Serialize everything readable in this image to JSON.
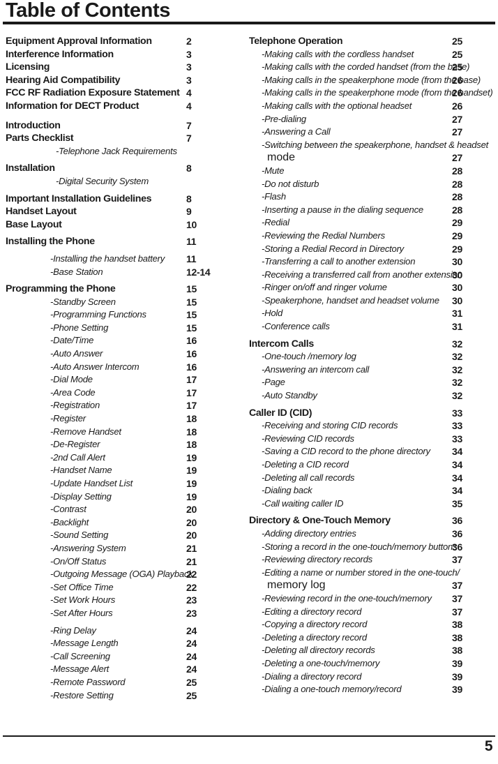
{
  "title": "Table of Contents",
  "footer": {
    "page_number": "5"
  },
  "left_column": [
    {
      "type": "major",
      "label": "Equipment Approval Information",
      "page": "2"
    },
    {
      "type": "major",
      "label": "Interference Information",
      "page": "3"
    },
    {
      "type": "major",
      "label": "Licensing",
      "page": "3"
    },
    {
      "type": "major",
      "label": "Hearing Aid Compatibility",
      "page": "3"
    },
    {
      "type": "major",
      "label": "FCC RF Radiation Exposure Statement",
      "page": "4"
    },
    {
      "type": "major",
      "label": "Information for DECT Product",
      "page": "4"
    },
    {
      "type": "gap",
      "size": "md"
    },
    {
      "type": "major",
      "label": "Introduction",
      "page": "7"
    },
    {
      "type": "major",
      "label": "Parts Checklist",
      "page": "7"
    },
    {
      "type": "sub",
      "deep": true,
      "label": "-Telephone Jack Requirements",
      "page": ""
    },
    {
      "type": "gap",
      "size": "sm"
    },
    {
      "type": "major",
      "label": "Installation",
      "page": "8"
    },
    {
      "type": "sub",
      "deep": true,
      "label": "-Digital Security System",
      "page": ""
    },
    {
      "type": "gap",
      "size": "sm"
    },
    {
      "type": "major",
      "label": "Important Installation Guidelines",
      "page": "8"
    },
    {
      "type": "major",
      "label": "Handset Layout",
      "page": "9"
    },
    {
      "type": "major",
      "label": "Base Layout",
      "page": "10"
    },
    {
      "type": "gap",
      "size": "sm"
    },
    {
      "type": "major",
      "label": "Installing the Phone",
      "page": "11"
    },
    {
      "type": "gap",
      "size": "sm"
    },
    {
      "type": "sub",
      "label": "-Installing the handset battery",
      "page": "11"
    },
    {
      "type": "sub",
      "label": "-Base Station",
      "page": "12-14"
    },
    {
      "type": "gap",
      "size": "sm"
    },
    {
      "type": "major",
      "label": "Programming the Phone",
      "page": "15"
    },
    {
      "type": "sub",
      "label": "-Standby Screen",
      "page": "15"
    },
    {
      "type": "sub",
      "label": "-Programming Functions",
      "page": "15"
    },
    {
      "type": "sub",
      "label": "-Phone Setting",
      "page": "15"
    },
    {
      "type": "sub",
      "label": "-Date/Time",
      "page": "16"
    },
    {
      "type": "sub",
      "label": "-Auto Answer",
      "page": "16"
    },
    {
      "type": "sub",
      "label": "-Auto Answer Intercom",
      "page": "16"
    },
    {
      "type": "sub",
      "label": "-Dial Mode",
      "page": "17"
    },
    {
      "type": "sub",
      "label": "-Area Code",
      "page": "17"
    },
    {
      "type": "sub",
      "label": "-Registration",
      "page": "17"
    },
    {
      "type": "sub",
      "label": "-Register",
      "page": "18"
    },
    {
      "type": "sub",
      "label": "-Remove Handset",
      "page": "18"
    },
    {
      "type": "sub",
      "label": "-De-Register",
      "page": "18"
    },
    {
      "type": "sub",
      "label": "-2nd Call Alert",
      "page": "19"
    },
    {
      "type": "sub",
      "label": "-Handset Name",
      "page": "19"
    },
    {
      "type": "sub",
      "label": "-Update Handset List",
      "page": "19"
    },
    {
      "type": "sub",
      "label": "-Display Setting",
      "page": "19"
    },
    {
      "type": "sub",
      "label": "-Contrast",
      "page": "20"
    },
    {
      "type": "sub",
      "label": "-Backlight",
      "page": "20"
    },
    {
      "type": "sub",
      "label": "-Sound Setting",
      "page": "20"
    },
    {
      "type": "sub",
      "label": "-Answering System",
      "page": "21"
    },
    {
      "type": "sub",
      "label": "-On/Off Status",
      "page": "21"
    },
    {
      "type": "sub",
      "label": "-Outgoing Message (OGA)  Playback",
      "page": "22"
    },
    {
      "type": "sub",
      "label": "-Set Office Time",
      "page": "22"
    },
    {
      "type": "sub",
      "label": "-Set Work Hours",
      "page": "23"
    },
    {
      "type": "sub",
      "label": "-Set After Hours",
      "page": "23"
    },
    {
      "type": "gap",
      "size": "sm"
    },
    {
      "type": "sub",
      "label": "-Ring Delay",
      "page": "24"
    },
    {
      "type": "sub",
      "label": "-Message Length",
      "page": "24"
    },
    {
      "type": "sub",
      "label": "-Call Screening",
      "page": "24"
    },
    {
      "type": "sub",
      "label": "-Message Alert",
      "page": "24"
    },
    {
      "type": "sub",
      "label": "-Remote Password",
      "page": "25"
    },
    {
      "type": "sub",
      "label": "-Restore Setting",
      "page": "25"
    }
  ],
  "right_column": [
    {
      "type": "major",
      "label": "Telephone Operation",
      "page": "25"
    },
    {
      "type": "sub",
      "label": "-Making calls with the cordless handset",
      "page": "25"
    },
    {
      "type": "sub",
      "label": "-Making calls with the corded handset (from the base)",
      "page": "25"
    },
    {
      "type": "sub",
      "label": "-Making calls in the speakerphone mode (from the base)",
      "page": "26"
    },
    {
      "type": "sub",
      "label": "-Making calls in the speakerphone mode (from the handset)",
      "page": "26"
    },
    {
      "type": "sub",
      "label": "-Making calls with the optional headset",
      "page": "26"
    },
    {
      "type": "sub",
      "label": "-Pre-dialing",
      "page": "27"
    },
    {
      "type": "sub",
      "label": "-Answering a Call",
      "page": "27"
    },
    {
      "type": "sub",
      "label": "-Switching between the speakerphone, handset & headset",
      "page": ""
    },
    {
      "type": "cont",
      "label": "mode",
      "page": "27"
    },
    {
      "type": "sub",
      "label": "-Mute",
      "page": "28"
    },
    {
      "type": "sub",
      "label": "-Do not disturb",
      "page": "28"
    },
    {
      "type": "sub",
      "label": "-Flash",
      "page": "28"
    },
    {
      "type": "sub",
      "label": "-Inserting a pause in the dialing sequence",
      "page": "28"
    },
    {
      "type": "sub",
      "label": "-Redial",
      "page": "29"
    },
    {
      "type": "sub",
      "label": "-Reviewing the Redial Numbers",
      "page": "29"
    },
    {
      "type": "sub",
      "label": "-Storing a Redial Record in Directory",
      "page": "29"
    },
    {
      "type": "sub",
      "label": "-Transferring a call to another extension",
      "page": "30"
    },
    {
      "type": "sub",
      "label": "-Receiving a transferred call from another extension",
      "page": "30"
    },
    {
      "type": "sub",
      "label": "-Ringer on/off and ringer volume",
      "page": "30"
    },
    {
      "type": "sub",
      "label": "-Speakerphone, handset and headset volume",
      "page": "30"
    },
    {
      "type": "sub",
      "label": "-Hold",
      "page": "31"
    },
    {
      "type": "sub",
      "label": "-Conference calls",
      "page": "31"
    },
    {
      "type": "gap",
      "size": "sm"
    },
    {
      "type": "major",
      "label": "Intercom Calls",
      "page": "32"
    },
    {
      "type": "sub",
      "label": "-One-touch /memory log",
      "page": "32"
    },
    {
      "type": "sub",
      "label": "-Answering an intercom call",
      "page": "32"
    },
    {
      "type": "sub",
      "label": "-Page",
      "page": "32"
    },
    {
      "type": "sub",
      "label": "-Auto Standby",
      "page": "32"
    },
    {
      "type": "gap",
      "size": "sm"
    },
    {
      "type": "major",
      "label": "Caller ID (CID)",
      "page": "33"
    },
    {
      "type": "sub",
      "label": "-Receiving and storing CID records",
      "page": "33"
    },
    {
      "type": "sub",
      "label": "-Reviewing CID records",
      "page": "33"
    },
    {
      "type": "sub",
      "label": "-Saving a CID record to the phone directory",
      "page": "34"
    },
    {
      "type": "sub",
      "label": "-Deleting a CID record",
      "page": "34"
    },
    {
      "type": "sub",
      "label": "-Deleting all call records",
      "page": "34"
    },
    {
      "type": "sub",
      "label": "-Dialing back",
      "page": "34"
    },
    {
      "type": "sub",
      "label": "-Call waiting caller ID",
      "page": "35"
    },
    {
      "type": "gap",
      "size": "sm"
    },
    {
      "type": "major",
      "label": "Directory & One-Touch Memory",
      "page": "36"
    },
    {
      "type": "sub",
      "label": "-Adding directory entries",
      "page": "36"
    },
    {
      "type": "sub",
      "label": "-Storing a record in the one-touch/memory buttons",
      "page": "36"
    },
    {
      "type": "sub",
      "label": "-Reviewing directory records",
      "page": "37"
    },
    {
      "type": "sub",
      "label": "-Editing a name or number stored in the one-touch/",
      "page": ""
    },
    {
      "type": "cont",
      "label": "memory log",
      "page": "37"
    },
    {
      "type": "sub",
      "label": "-Reviewing record in the one-touch/memory",
      "page": "37"
    },
    {
      "type": "sub",
      "label": "-Editing a directory record",
      "page": "37"
    },
    {
      "type": "sub",
      "label": "-Copying a directory record",
      "page": "38"
    },
    {
      "type": "sub",
      "label": "-Deleting a directory record",
      "page": "38"
    },
    {
      "type": "sub",
      "label": "-Deleting all directory records",
      "page": "38"
    },
    {
      "type": "sub",
      "label": "-Deleting a one-touch/memory",
      "page": "39"
    },
    {
      "type": "sub",
      "label": "-Dialing a directory record",
      "page": "39"
    },
    {
      "type": "sub",
      "label": "-Dialing a one-touch memory/record",
      "page": "39"
    }
  ]
}
